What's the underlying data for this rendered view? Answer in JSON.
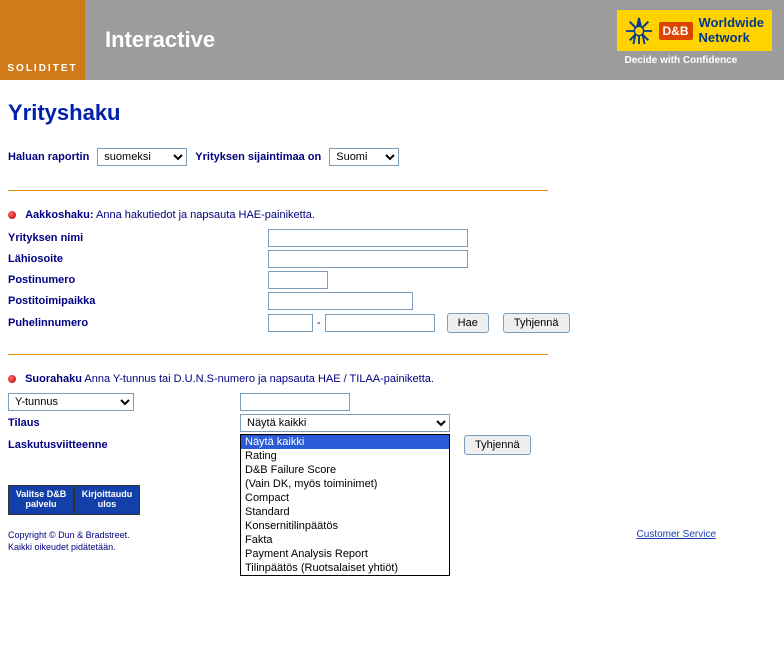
{
  "header": {
    "logo_text": "SOLIDITET",
    "title": "Interactive",
    "dnb": {
      "square": "D&B",
      "line1": "Worldwide",
      "line2": "Network",
      "tagline": "Decide with Confidence"
    }
  },
  "page_title": "Yrityshaku",
  "top_row": {
    "report_label": "Haluan raportin",
    "report_options": [
      "suomeksi"
    ],
    "report_selected": "suomeksi",
    "country_label": "Yrityksen sijaintimaa on",
    "country_options": [
      "Suomi"
    ],
    "country_selected": "Suomi"
  },
  "alpha": {
    "heading_bold": "Aakkoshaku:",
    "heading_rest": "Anna hakutiedot ja napsauta HAE-painiketta.",
    "fields": {
      "company_name": "Yrityksen nimi",
      "street": "Lähiosoite",
      "postcode": "Postinumero",
      "city": "Postitoimipaikka",
      "phone": "Puhelinnumero",
      "phone_sep": "-"
    },
    "btn_search": "Hae",
    "btn_clear": "Tyhjennä"
  },
  "direct": {
    "heading_bold": "Suorahaku",
    "heading_rest": "Anna Y-tunnus tai D.U.N.S-numero ja napsauta HAE / TILAA-painiketta.",
    "id_options": [
      "Y-tunnus"
    ],
    "id_selected": "Y-tunnus",
    "order_label": "Tilaus",
    "order_selected": "Näytä kaikki",
    "order_options": [
      "Näytä kaikki",
      "Rating",
      "D&B Failure Score",
      "(Vain DK, myös toiminimet)",
      "Compact",
      "Standard",
      "Konsernitilinpäätös",
      "Fakta",
      "Payment Analysis Report",
      "Tilinpäätös (Ruotsalaiset yhtiöt)"
    ],
    "ref_label": "Laskutusviitteenne",
    "btn_clear": "Tyhjennä"
  },
  "footer_buttons": {
    "choose": "Valitse D&B palvelu",
    "logout": "Kirjoittaudu ulos"
  },
  "copyright": {
    "line1": "Copyright © Dun & Bradstreet.",
    "line2": "Kaikki oikeudet pidätetään."
  },
  "customer_service": "Customer Service"
}
